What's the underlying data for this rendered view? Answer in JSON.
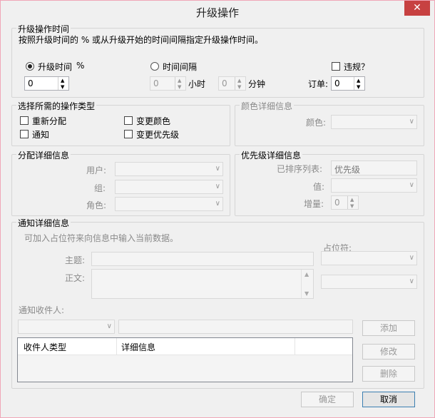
{
  "window": {
    "title": "升级操作",
    "close_glyph": "✕"
  },
  "escalation_time": {
    "group_label": "升级操作时间",
    "description": "按照升级时间的 % 或从升级开始的时间间隔指定升级操作时间。",
    "radio_percent_label": "升级时间",
    "percent_sign": "%",
    "percent_value": "0",
    "radio_interval_label": "时间间隔",
    "hours_value": "0",
    "hours_label": "小时",
    "minutes_value": "0",
    "minutes_label": "分钟",
    "violation_label": "违规？",
    "order_label": "订单:",
    "order_value": "0"
  },
  "action_types": {
    "group_label": "选择所需的操作类型",
    "reassign": "重新分配",
    "notify": "通知",
    "change_color": "变更颜色",
    "change_priority": "变更优先级"
  },
  "color_details": {
    "group_label": "颜色详细信息",
    "color_label": "颜色:"
  },
  "assignment_details": {
    "group_label": "分配详细信息",
    "user_label": "用户:",
    "group_field_label": "组:",
    "role_label": "角色:"
  },
  "priority_details": {
    "group_label": "优先级详细信息",
    "sorted_list_label": "已排序列表:",
    "sorted_list_value": "优先级",
    "value_label": "值:",
    "increment_label": "增量:",
    "increment_value": "0"
  },
  "notification_details": {
    "group_label": "通知详细信息",
    "hint": "可加入占位符来向信息中输入当前数据。",
    "placeholder_label": "占位符:",
    "subject_label": "主题:",
    "body_label": "正文:",
    "recipients_label": "通知收件人:",
    "add_button": "添加",
    "edit_button": "修改",
    "delete_button": "删除",
    "columns": [
      "收件人类型",
      "详细信息"
    ]
  },
  "footer": {
    "ok_button": "确定",
    "cancel_button": "取消"
  },
  "colors": {
    "close_button": "#c74141",
    "default_button_border": "#3c7fb1"
  }
}
